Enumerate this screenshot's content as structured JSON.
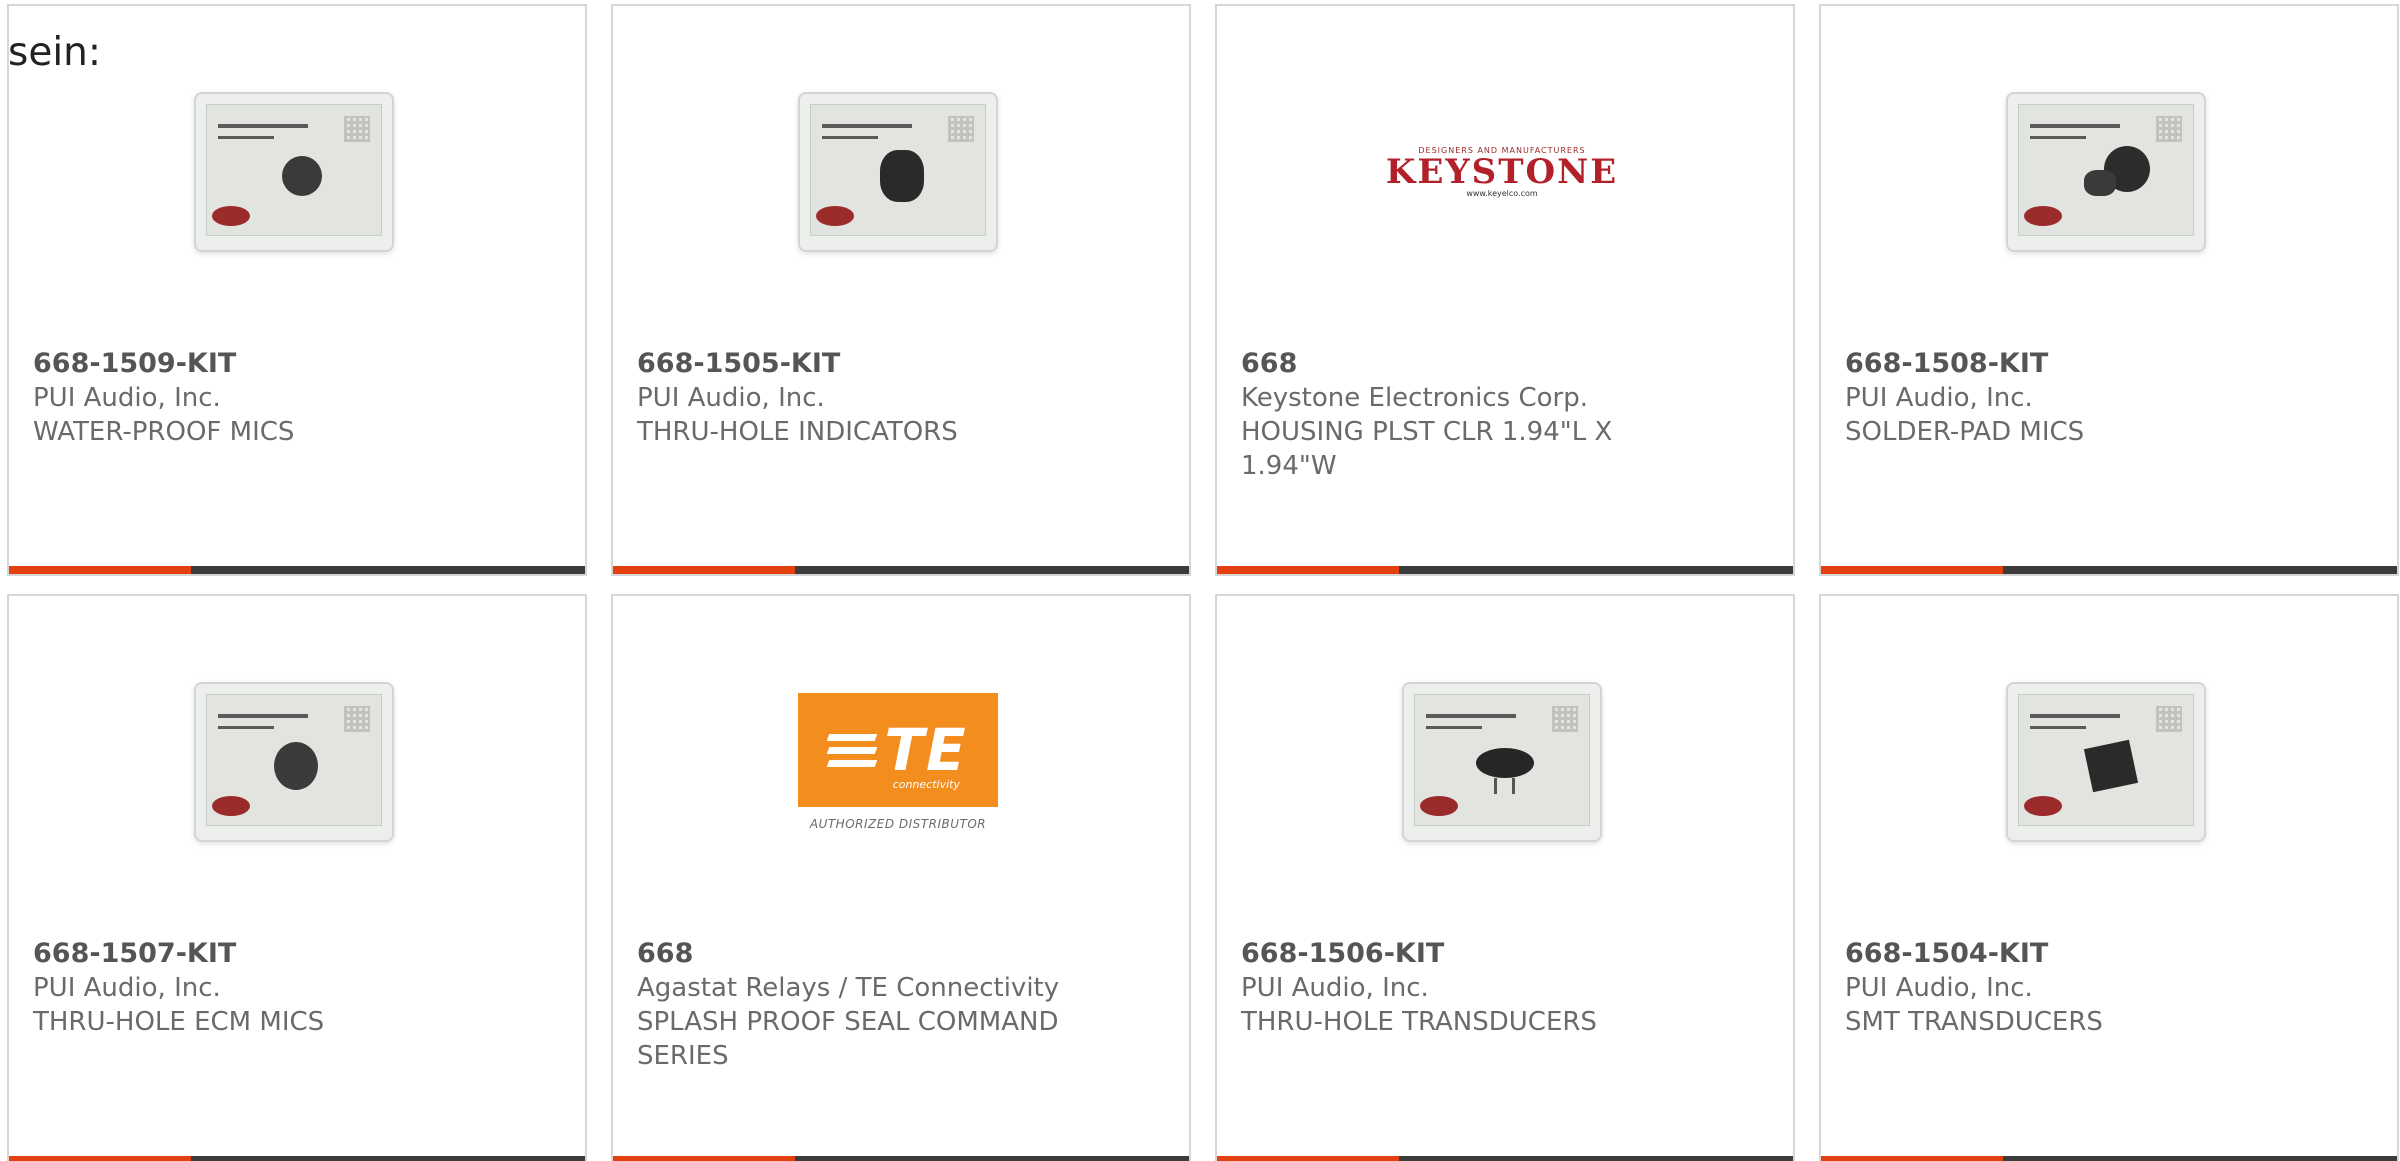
{
  "intro_text": "sein:",
  "colors": {
    "accent": "#e4400f",
    "bar": "#3c3c3c",
    "border": "#d6d6d6"
  },
  "cards": [
    {
      "part_number": "668-1509-KIT",
      "manufacturer": "PUI Audio, Inc.",
      "description": "WATER-PROOF MICS",
      "image": "kit-box-image"
    },
    {
      "part_number": "668-1505-KIT",
      "manufacturer": "PUI Audio, Inc.",
      "description": "THRU-HOLE INDICATORS",
      "image": "kit-box-image"
    },
    {
      "part_number": "668",
      "manufacturer": "Keystone Electronics Corp.",
      "description": "HOUSING PLST CLR 1.94\"L X 1.94\"W",
      "image": "keystone-logo",
      "logo": {
        "tagline": "DESIGNERS AND MANUFACTURERS",
        "name": "KEYSTONE",
        "url": "www.keyelco.com"
      }
    },
    {
      "part_number": "668-1508-KIT",
      "manufacturer": "PUI Audio, Inc.",
      "description": "SOLDER-PAD MICS",
      "image": "kit-box-image"
    },
    {
      "part_number": "668-1507-KIT",
      "manufacturer": "PUI Audio, Inc.",
      "description": "THRU-HOLE ECM MICS",
      "image": "kit-box-image"
    },
    {
      "part_number": "668",
      "manufacturer": "Agastat Relays / TE Connectivity",
      "description": "SPLASH PROOF SEAL COMMAND SERIES",
      "image": "te-logo",
      "logo": {
        "name": "TE",
        "sub": "connectivity",
        "caption": "AUTHORIZED DISTRIBUTOR"
      }
    },
    {
      "part_number": "668-1506-KIT",
      "manufacturer": "PUI Audio, Inc.",
      "description": "THRU-HOLE TRANSDUCERS",
      "image": "kit-box-image"
    },
    {
      "part_number": "668-1504-KIT",
      "manufacturer": "PUI Audio, Inc.",
      "description": "SMT TRANSDUCERS",
      "image": "kit-box-image"
    }
  ]
}
